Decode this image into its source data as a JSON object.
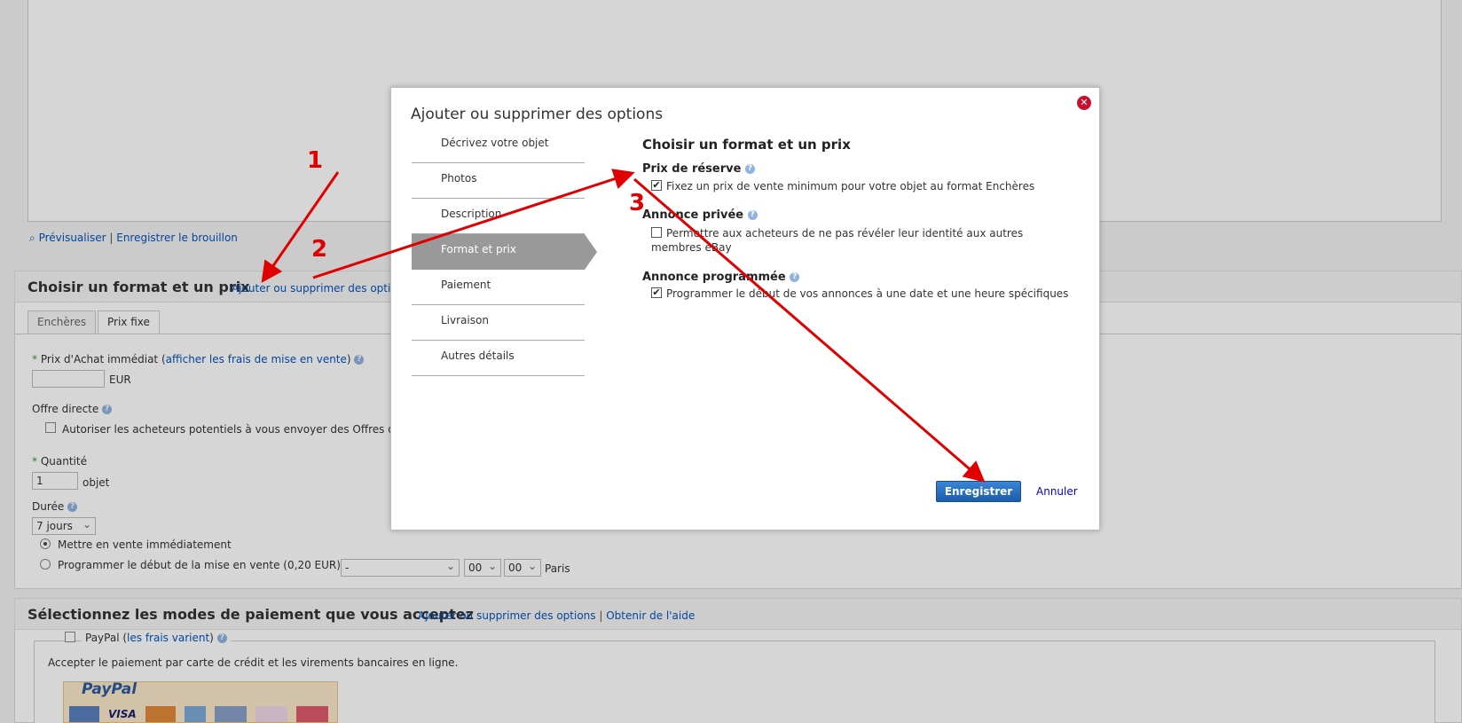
{
  "background": {
    "preview_link": "Prévisualiser",
    "separator": "|",
    "draft_link": "Enregistrer le brouillon",
    "format_section": {
      "title": "Choisir un format et un prix",
      "link": "Ajouter ou supprimer des option",
      "tabs": [
        "Enchères",
        "Prix fixe"
      ],
      "buy_now_label_prefix": "Prix d'Achat immédiat (",
      "buy_now_link": "afficher les frais de mise en vente",
      "buy_now_label_suffix": ")",
      "currency": "EUR",
      "direct_offer_label": "Offre directe",
      "direct_offer_checkbox": "Autoriser les acheteurs potentiels à vous envoyer des Offres dire",
      "quantity_label": "Quantité",
      "quantity_value": "1",
      "quantity_unit": "objet",
      "duration_label": "Durée",
      "duration_value": "7 jours",
      "start_now": "Mettre en vente immédiatement",
      "schedule_start": "Programmer le début de la mise en vente (0,20 EUR)",
      "date_value": "-",
      "hour_value": "00",
      "minute_value": "00",
      "timezone": "Paris"
    },
    "payment_section": {
      "title": "Sélectionnez les modes de paiement que vous acceptez",
      "link_options": "Ajouter ou supprimer des options",
      "link_help": "Obtenir de l'aide",
      "paypal_label": "PayPal (",
      "paypal_link": "les frais varient",
      "paypal_suffix": ")",
      "paypal_desc": "Accepter le paiement par carte de crédit et les virements bancaires en ligne.",
      "paypal_logo": "PayPal",
      "card_logos": [
        "VISA"
      ]
    }
  },
  "modal": {
    "title": "Ajouter ou supprimer des options",
    "nav": [
      "Décrivez votre objet",
      "Photos",
      "Description",
      "Format et prix",
      "Paiement",
      "Livraison",
      "Autres détails"
    ],
    "active_nav_index": 3,
    "content_title": "Choisir un format et un prix",
    "options": [
      {
        "heading": "Prix de réserve",
        "text": "Fixez un prix de vente minimum pour votre objet au format Enchères",
        "checked": true
      },
      {
        "heading": "Annonce privée",
        "text": "Permettre aux acheteurs de ne pas révéler leur identité aux autres membres eBay",
        "checked": false
      },
      {
        "heading": "Annonce programmée",
        "text": "Programmer le début de vos annonces à une date et une heure spécifiques",
        "checked": true
      }
    ],
    "save_label": "Enregistrer",
    "cancel_label": "Annuler",
    "close_icon": "close-icon"
  },
  "annotations": {
    "labels": [
      "1",
      "2",
      "3"
    ],
    "color": "#e00000"
  },
  "colors": {
    "accent": "#0654ba",
    "save_button": "#1c5ea8",
    "active_nav": "#999999",
    "close": "#c8102e"
  }
}
